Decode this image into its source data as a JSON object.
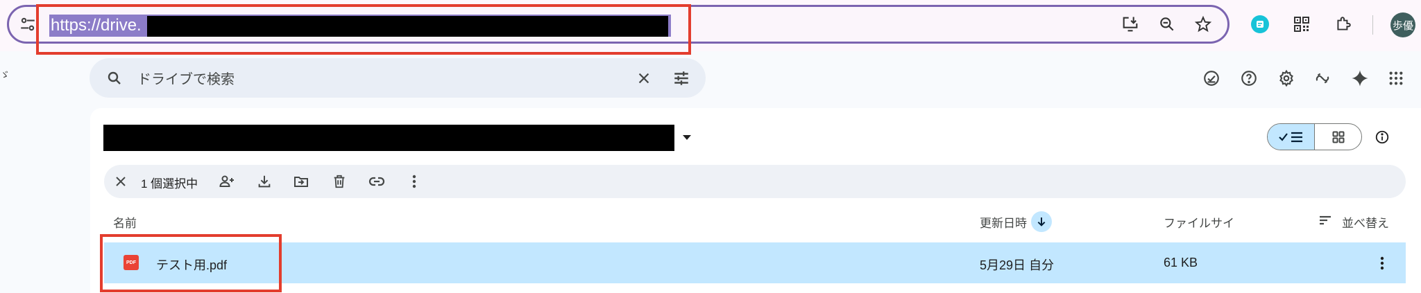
{
  "browser": {
    "url": "https://drive.",
    "toolbar_icons": [
      "tune-icon",
      "install-app-icon",
      "zoom-out-icon",
      "bookmark-star-icon",
      "extension-badge-icon",
      "qr-code-icon",
      "extensions-puzzle-icon"
    ],
    "avatar_text": "歩優",
    "accent_color": "#7b64b0",
    "selection_color": "#8c7cc8"
  },
  "drive": {
    "search_placeholder": "ドライブで検索",
    "header_icons": [
      "offline-ready-icon",
      "help-icon",
      "settings-icon",
      "gemini-link-icon",
      "gemini-sparkle-icon",
      "apps-grid-icon"
    ],
    "selection": {
      "count_label": "1 個選択中",
      "actions": [
        "share-icon",
        "download-icon",
        "move-icon",
        "trash-icon",
        "copy-link-icon",
        "more-vert-icon"
      ]
    },
    "columns": {
      "name": "名前",
      "modified": "更新日時",
      "size": "ファイルサイ",
      "sort": "並べ替え"
    },
    "files": [
      {
        "icon_label": "PDF",
        "name": "テスト用.pdf",
        "modified": "5月29日 自分",
        "size": "61 KB",
        "selected": true
      }
    ],
    "colors": {
      "selected_row": "#c2e7ff",
      "pdf": "#ea4335",
      "highlight_box": "#e33d2e"
    }
  }
}
